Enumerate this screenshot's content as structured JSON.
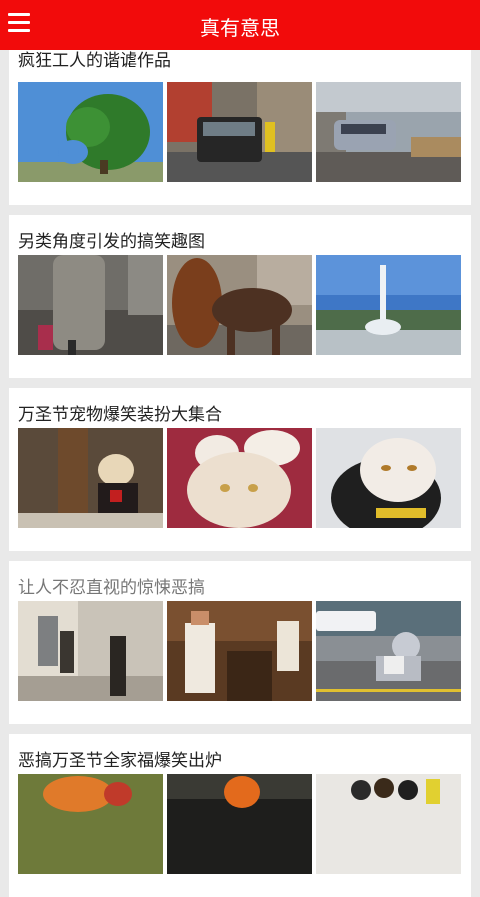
{
  "header": {
    "title": "真有意思",
    "menu_icon": "menu-icon"
  },
  "articles": [
    {
      "title": "疯狂工人的谐谑作品",
      "thumbs": [
        "tree-sculpture-photo",
        "suv-in-alley-photo",
        "car-on-street-photo"
      ]
    },
    {
      "title": "另类角度引发的搞笑趣图",
      "thumbs": [
        "person-in-coat-photo",
        "woman-and-horse-photo",
        "fountain-photo"
      ]
    },
    {
      "title": "万圣节宠物爆笑装扮大集合",
      "thumbs": [
        "dog-in-costume-photo",
        "bunny-ears-cat-photo",
        "bee-costume-cat-photo"
      ]
    },
    {
      "title": "让人不忍直视的惊悚恶搞",
      "thumbs": [
        "street-scene-photo",
        "nurse-figure-photo",
        "alien-reading-photo"
      ]
    },
    {
      "title": "恶搞万圣节全家福爆笑出炉",
      "thumbs": [
        "costume-family-photo",
        "pumpkin-head-photo",
        "group-costume-photo"
      ]
    }
  ]
}
